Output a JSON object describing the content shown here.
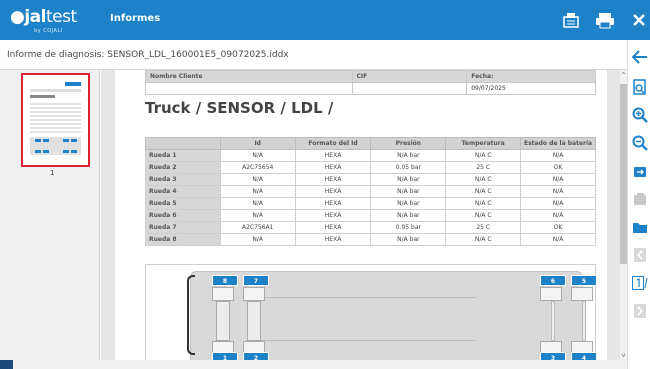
{
  "app": {
    "logo_main": "jal",
    "logo_thin": "test",
    "logo_sub": "by COJALI",
    "title": "Informes"
  },
  "file": {
    "label": "Informe de diagnosis: SENSOR_LDL_160001E5_09072025.iddx"
  },
  "thumbnails": [
    {
      "page_number": "1"
    }
  ],
  "report": {
    "header": {
      "cliente_label": "Nombre Cliente",
      "cliente_value": "",
      "cif_label": "CIF",
      "cif_value": "",
      "fecha_label": "Fecha:",
      "fecha_value": "09/07/2025"
    },
    "title": "Truck / SENSOR / LDL /",
    "columns": [
      "",
      "Id",
      "Formato del Id",
      "Presión",
      "Temperatura",
      "Estado de la batería"
    ],
    "rows": [
      [
        "Rueda 1",
        "N/A",
        "HEXA",
        "N/A bar",
        "N/A C",
        "N/A"
      ],
      [
        "Rueda 2",
        "A2C75654",
        "HEXA",
        "0.05 bar",
        "25 C",
        "OK"
      ],
      [
        "Rueda 3",
        "N/A",
        "HEXA",
        "N/A bar",
        "N/A C",
        "N/A"
      ],
      [
        "Rueda 4",
        "N/A",
        "HEXA",
        "N/A bar",
        "N/A C",
        "N/A"
      ],
      [
        "Rueda 5",
        "N/A",
        "HEXA",
        "N/A bar",
        "N/A C",
        "N/A"
      ],
      [
        "Rueda 6",
        "N/A",
        "HEXA",
        "N/A bar",
        "N/A C",
        "N/A"
      ],
      [
        "Rueda 7",
        "A2C756A1",
        "HEXA",
        "0.05 bar",
        "25 C",
        "OK"
      ],
      [
        "Rueda 8",
        "N/A",
        "HEXA",
        "N/A bar",
        "N/A C",
        "N/A"
      ]
    ],
    "wheels": [
      "8",
      "7",
      "6",
      "5",
      "1",
      "2",
      "3",
      "4"
    ]
  },
  "toolbar_titlebar": [
    "report-icon",
    "print-icon",
    "close-icon"
  ],
  "toolbar_right": [
    "back-icon",
    "search-doc-icon",
    "zoom-in-icon",
    "zoom-out-icon",
    "export-icon",
    "copy-icon",
    "folder-icon",
    "prev-page-icon",
    "page-number-icon",
    "next-page-icon"
  ],
  "colors": {
    "accent": "#1e82c8",
    "thumb_border": "#d9232e"
  }
}
